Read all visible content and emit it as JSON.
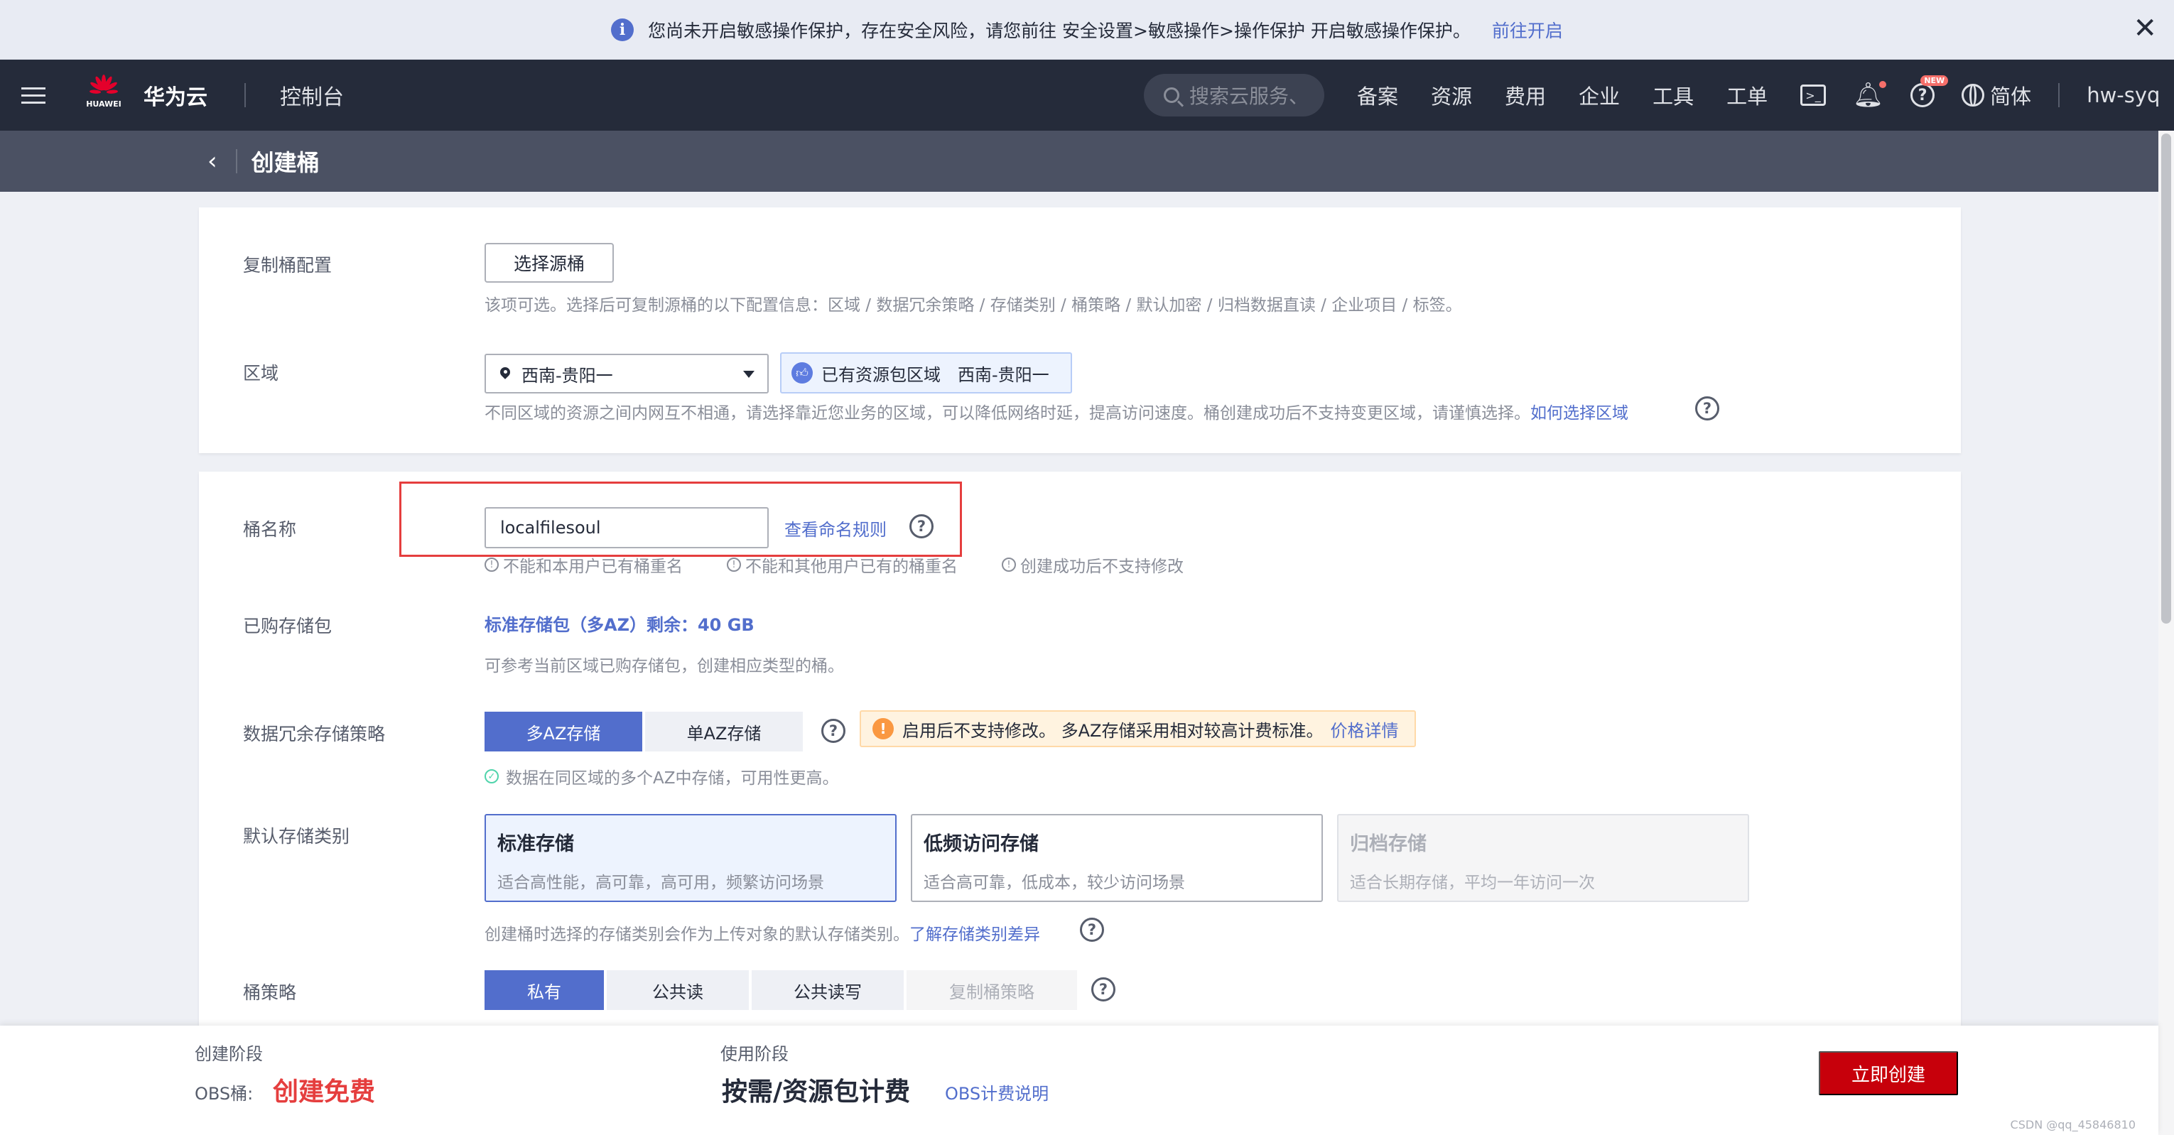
{
  "notice": {
    "text": "您尚未开启敏感操作保护，存在安全风险，请您前往 安全设置>敏感操作>操作保护 开启敏感操作保护。",
    "link": "前往开启",
    "close": "✕"
  },
  "topnav": {
    "logo_text": "HUAWEI",
    "brand": "华为云",
    "console": "控制台",
    "search_placeholder": "搜索云服务、",
    "items": [
      "备案",
      "资源",
      "费用",
      "企业",
      "工具",
      "工单"
    ],
    "new_badge": "NEW",
    "language": "简体",
    "user": "hw-syq"
  },
  "subhead": {
    "title": "创建桶"
  },
  "replicate": {
    "label": "复制桶配置",
    "button": "选择源桶",
    "hint": "该项可选。选择后可复制源桶的以下配置信息：区域 / 数据冗余策略 / 存储类别 / 桶策略 / 默认加密 / 归档数据直读 / 企业项目 / 标签。"
  },
  "region": {
    "label": "区域",
    "value": "西南-贵阳一",
    "pkg_tag_prefix": "已有资源包区域",
    "pkg_tag_region": "西南-贵阳一",
    "hint": "不同区域的资源之间内网互不相通，请选择靠近您业务的区域，可以降低网络时延，提高访问速度。桶创建成功后不支持变更区域，请谨慎选择。",
    "hint_link": "如何选择区域"
  },
  "bucket_name": {
    "label": "桶名称",
    "value": "localfilesoul",
    "rule_link": "查看命名规则",
    "rules": [
      "不能和本用户已有桶重名",
      "不能和其他用户已有的桶重名",
      "创建成功后不支持修改"
    ]
  },
  "purchased": {
    "label": "已购存储包",
    "value": "标准存储包（多AZ）剩余：40 GB",
    "hint": "可参考当前区域已购存储包，创建相应类型的桶。"
  },
  "redundancy": {
    "label": "数据冗余存储策略",
    "options": [
      "多AZ存储",
      "单AZ存储"
    ],
    "warn": "启用后不支持修改。 多AZ存储采用相对较高计费标准。",
    "warn_link": "价格详情",
    "ok_hint": "数据在同区域的多个AZ中存储，可用性更高。"
  },
  "storage_class": {
    "label": "默认存储类别",
    "options": [
      {
        "title": "标准存储",
        "desc": "适合高性能，高可靠，高可用，频繁访问场景"
      },
      {
        "title": "低频访问存储",
        "desc": "适合高可靠，低成本，较少访问场景"
      },
      {
        "title": "归档存储",
        "desc": "适合长期存储，平均一年访问一次"
      }
    ],
    "hint": "创建桶时选择的存储类别会作为上传对象的默认存储类别。",
    "hint_link": "了解存储类别差异"
  },
  "policy": {
    "label": "桶策略",
    "options": [
      "私有",
      "公共读",
      "公共读写",
      "复制桶策略"
    ]
  },
  "footer": {
    "stage1_label": "创建阶段",
    "obs_label": "OBS桶:",
    "obs_value": "创建免费",
    "stage2_label": "使用阶段",
    "stage2_value": "按需/资源包计费",
    "billing_link": "OBS计费说明",
    "create_button": "立即创建",
    "watermark": "CSDN @qq_45846810"
  }
}
